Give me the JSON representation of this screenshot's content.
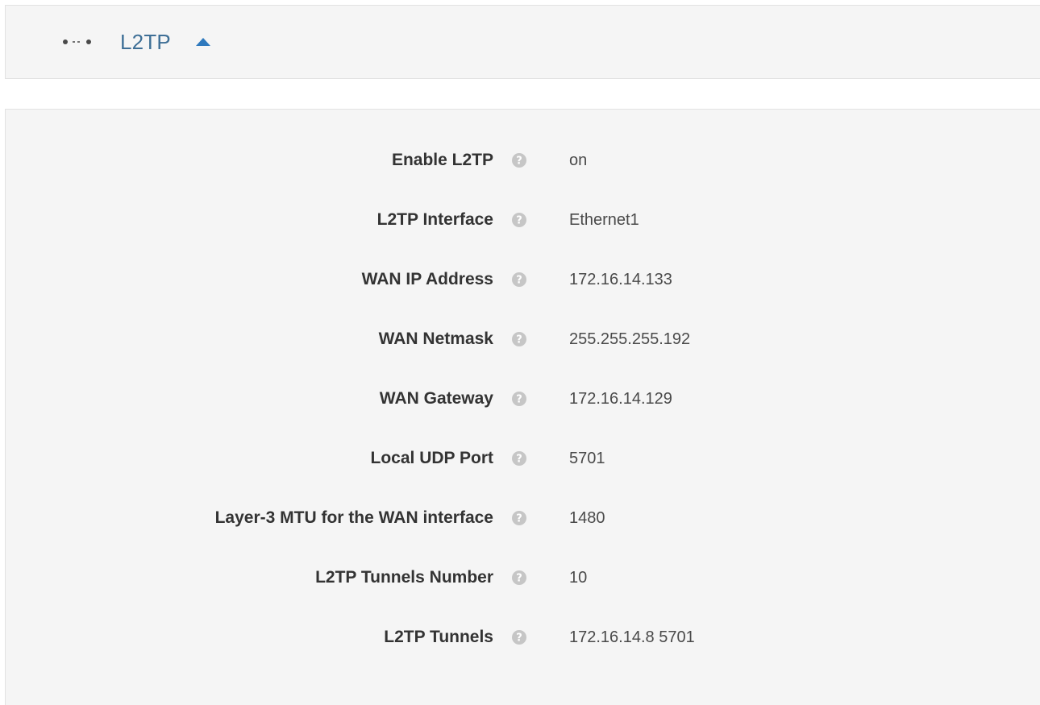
{
  "header": {
    "icon": "connection-dots-icon",
    "title": "L2TP",
    "toggle_icon": "caret-up-icon",
    "accent_color": "#3e6f96"
  },
  "fields": [
    {
      "label": "Enable L2TP",
      "value": "on"
    },
    {
      "label": "L2TP Interface",
      "value": "Ethernet1"
    },
    {
      "label": "WAN IP Address",
      "value": "172.16.14.133"
    },
    {
      "label": "WAN Netmask",
      "value": "255.255.255.192"
    },
    {
      "label": "WAN Gateway",
      "value": "172.16.14.129"
    },
    {
      "label": "Local UDP Port",
      "value": "5701"
    },
    {
      "label": "Layer-3 MTU for the WAN interface",
      "value": "1480"
    },
    {
      "label": "L2TP Tunnels Number",
      "value": "10"
    },
    {
      "label": "L2TP Tunnels",
      "value": "172.16.14.8 5701"
    }
  ],
  "help_icon": "question-circle-icon"
}
